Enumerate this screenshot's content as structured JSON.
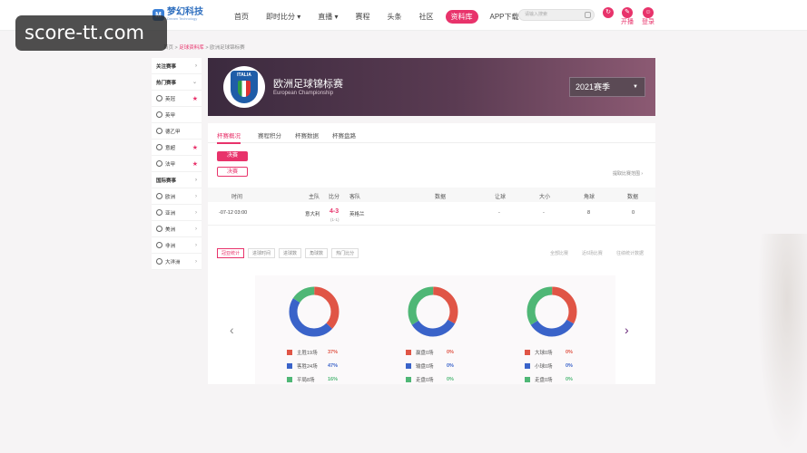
{
  "watermark": "score-tt.com",
  "logo": {
    "name": "梦幻科技",
    "sub": "Dream Technology"
  },
  "nav": {
    "items": [
      "首页",
      "即时比分",
      "直播",
      "赛程",
      "头条",
      "社区",
      "资料库",
      "APP下载"
    ],
    "search_placeholder": "请输入搜索",
    "fav_label": "开播",
    "login_label": "登录"
  },
  "breadcrumb": {
    "home": "首页",
    "sep1": " > ",
    "db": "足球资料库",
    "sep2": " > ",
    "current": "欧洲足球锦标赛"
  },
  "sidebar": {
    "items": [
      {
        "label": "关注赛事",
        "header": true,
        "mark": "›"
      },
      {
        "label": "热门赛事",
        "header": true,
        "mark": "⌄"
      },
      {
        "label": "英冠",
        "header": false,
        "mark": "★"
      },
      {
        "label": "英甲",
        "header": false,
        "mark": ""
      },
      {
        "label": "德乙甲",
        "header": false,
        "mark": ""
      },
      {
        "label": "意超",
        "header": false,
        "mark": "★"
      },
      {
        "label": "法甲",
        "header": false,
        "mark": "★"
      },
      {
        "label": "国际赛事",
        "header": true,
        "mark": "›"
      },
      {
        "label": "欧洲",
        "header": false,
        "mark": "›"
      },
      {
        "label": "亚洲",
        "header": false,
        "mark": "›"
      },
      {
        "label": "美洲",
        "header": false,
        "mark": "›"
      },
      {
        "label": "非洲",
        "header": false,
        "mark": "›"
      },
      {
        "label": "大洋洲",
        "header": false,
        "mark": "›"
      }
    ]
  },
  "banner": {
    "badge_text": "ITALIA",
    "title": "欧洲足球锦标赛",
    "subtitle": "European Championship",
    "season": "2021赛季"
  },
  "tabs": [
    "杯赛概况",
    "赛程积分",
    "杯赛数据",
    "杯赛盘路"
  ],
  "round_buttons": {
    "active": "决赛",
    "inactive": "决赛"
  },
  "collapse_link": "提取比赛范围 ›",
  "table": {
    "headers": [
      "时间",
      "主队",
      "比分",
      "客队",
      "数据",
      "让球",
      "大小",
      "角球",
      "数据"
    ],
    "row": {
      "time": "-07-12 03:00",
      "home": "意大利",
      "score": "4-3",
      "score_sub": "(1-1)",
      "away": "英格兰",
      "data": "",
      "handicap": "-",
      "ou": "-",
      "corner": "8",
      "data2": "0"
    }
  },
  "stat_tabs": [
    "冠亚统计",
    "进球时间",
    "进球数",
    "角球数",
    "热门比分"
  ],
  "right_links": [
    "全部比赛",
    "近6场比赛",
    "往绩统计数据"
  ],
  "charts": [
    {
      "slices": [
        {
          "label": "主胜19场",
          "pct": "37%",
          "value": 37,
          "color": "#e05546"
        },
        {
          "label": "客胜24场",
          "pct": "47%",
          "value": 47,
          "color": "#3a63c9"
        },
        {
          "label": "平局8场",
          "pct": "16%",
          "value": 16,
          "color": "#4fb776"
        }
      ]
    },
    {
      "slices": [
        {
          "label": "赢盘0场",
          "pct": "0%",
          "value": 33,
          "color": "#e05546"
        },
        {
          "label": "输盘0场",
          "pct": "0%",
          "value": 33,
          "color": "#3a63c9"
        },
        {
          "label": "走盘0场",
          "pct": "0%",
          "value": 34,
          "color": "#4fb776"
        }
      ]
    },
    {
      "slices": [
        {
          "label": "大球0场",
          "pct": "0%",
          "value": 33,
          "color": "#e05546"
        },
        {
          "label": "小球0场",
          "pct": "0%",
          "value": 33,
          "color": "#3a63c9"
        },
        {
          "label": "走盘0场",
          "pct": "0%",
          "value": 34,
          "color": "#4fb776"
        }
      ]
    }
  ]
}
